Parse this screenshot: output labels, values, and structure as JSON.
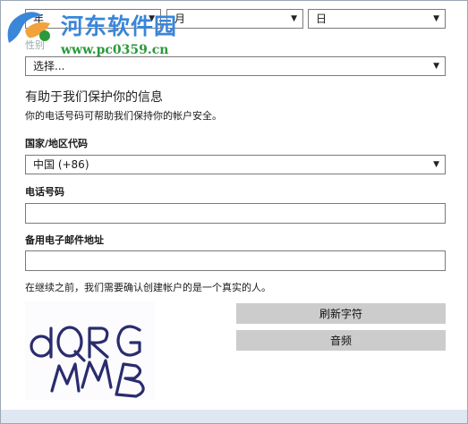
{
  "birth": {
    "year_label": "年",
    "month_label": "月",
    "day_label": "日"
  },
  "gender": {
    "label": "性别",
    "selected": "选择..."
  },
  "security": {
    "heading": "有助于我们保护你的信息",
    "description": "你的电话号码可帮助我们保持你的帐户安全。"
  },
  "country": {
    "label": "国家/地区代码",
    "selected": "中国 (+86)"
  },
  "phone": {
    "label": "电话号码",
    "value": ""
  },
  "alt_email": {
    "label": "备用电子邮件地址",
    "value": ""
  },
  "verify": {
    "prompt": "在继续之前，我们需要确认创建帐户的是一个真实的人。",
    "captcha_text": "dQRG MMB",
    "refresh_label": "刷新字符",
    "audio_label": "音频"
  },
  "watermark": {
    "site_name": "河东软件园",
    "url": "www.pc0359.cn"
  }
}
